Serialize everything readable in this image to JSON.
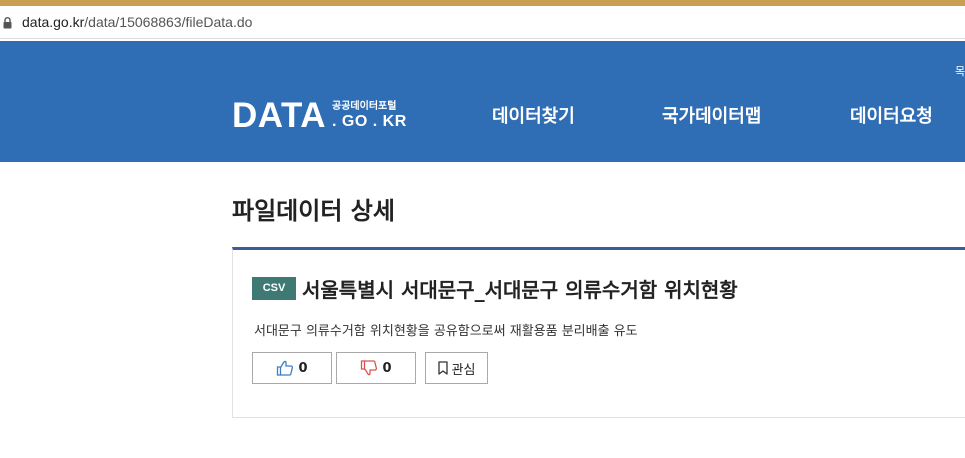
{
  "browser": {
    "url_host": "data.go.kr",
    "url_path": "/data/15068863/fileData.do"
  },
  "header": {
    "logo_main": "DATA",
    "logo_sub": "공공데이터포털",
    "logo_domain": ". GO . KR",
    "edge_text": "목",
    "nav": [
      "데이터찾기",
      "국가데이터맵",
      "데이터요청"
    ]
  },
  "page": {
    "title": "파일데이터 상세"
  },
  "dataset": {
    "badge": "CSV",
    "title": "서울특별시 서대문구_서대문구 의류수거함 위치현황",
    "description": "서대문구 의류수거함 위치현황을 공유함으로써 재활용품 분리배출 유도",
    "likes": "0",
    "dislikes": "0",
    "favorite_label": "관심"
  },
  "colors": {
    "header_bg": "#2f6db5",
    "badge_bg": "#3e7a73",
    "card_top_border": "#3c5d99",
    "like_icon": "#3a7fc4",
    "dislike_icon": "#d9534f"
  }
}
